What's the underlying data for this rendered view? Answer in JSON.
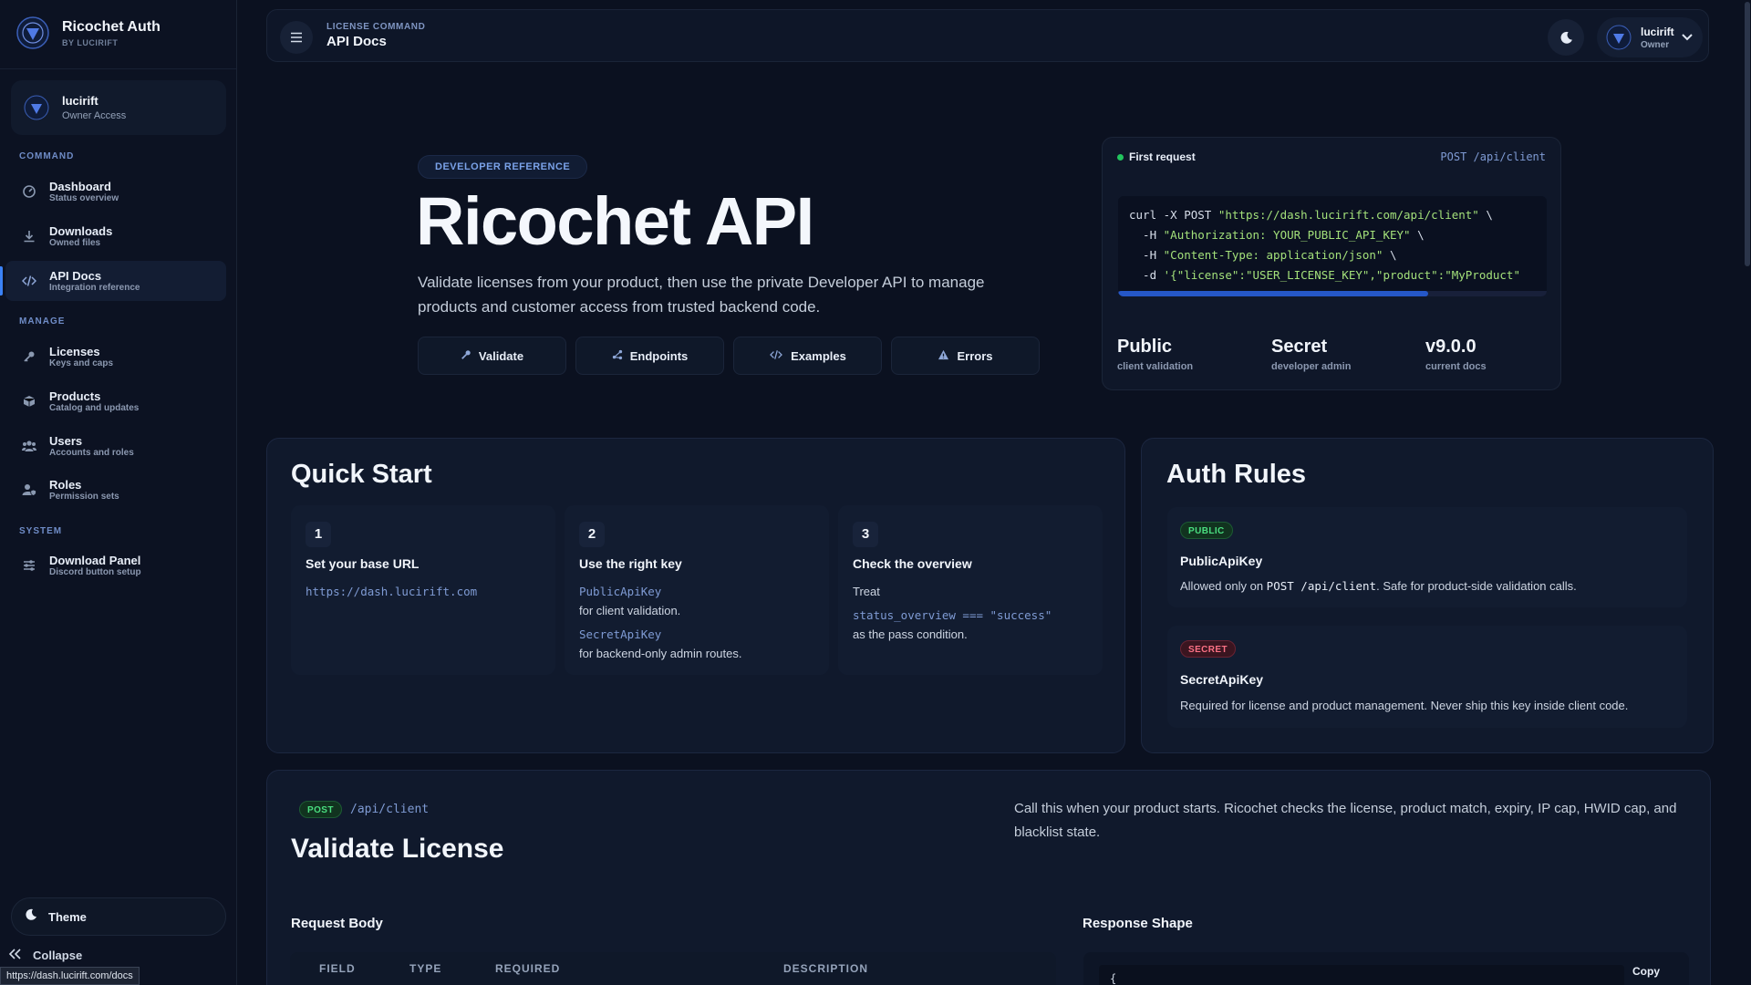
{
  "brand": {
    "title": "Ricochet Auth",
    "subtitle": "BY LUCIRIFT"
  },
  "user_card": {
    "name": "lucirift",
    "role": "Owner Access"
  },
  "sidebar": {
    "sections": {
      "command": "COMMAND",
      "manage": "MANAGE",
      "system": "SYSTEM"
    },
    "items": [
      {
        "label": "Dashboard",
        "sub": "Status overview",
        "icon": "dashboard-icon"
      },
      {
        "label": "Downloads",
        "sub": "Owned files",
        "icon": "download-icon"
      },
      {
        "label": "API Docs",
        "sub": "Integration reference",
        "icon": "code-icon",
        "active": true
      },
      {
        "label": "Licenses",
        "sub": "Keys and caps",
        "icon": "key-icon"
      },
      {
        "label": "Products",
        "sub": "Catalog and updates",
        "icon": "box-icon"
      },
      {
        "label": "Users",
        "sub": "Accounts and roles",
        "icon": "users-icon"
      },
      {
        "label": "Roles",
        "sub": "Permission sets",
        "icon": "user-shield-icon"
      },
      {
        "label": "Download Panel",
        "sub": "Discord button setup",
        "icon": "sliders-icon"
      }
    ],
    "theme_label": "Theme",
    "collapse_label": "Collapse"
  },
  "status_url": "https://dash.lucirift.com/docs",
  "topbar": {
    "eyebrow": "LICENSE COMMAND",
    "title": "API Docs",
    "user_name": "lucirift",
    "user_role": "Owner"
  },
  "hero": {
    "pill": "DEVELOPER REFERENCE",
    "title": "Ricochet API",
    "description": "Validate licenses from your product, then use the private Developer API to manage products and customer access from trusted backend code.",
    "tabs": [
      {
        "label": "Validate",
        "icon": "key-icon"
      },
      {
        "label": "Endpoints",
        "icon": "share-icon"
      },
      {
        "label": "Examples",
        "icon": "code-icon"
      },
      {
        "label": "Errors",
        "icon": "warning-icon"
      }
    ]
  },
  "first_request": {
    "label": "First request",
    "endpoint": "POST /api/client",
    "code": {
      "line1_cmd": "curl -X POST ",
      "line1_str": "\"https://dash.lucirift.com/api/client\"",
      "line1_end": " \\",
      "line2_cmd": "  -H ",
      "line2_str": "\"Authorization: YOUR_PUBLIC_API_KEY\"",
      "line2_end": " \\",
      "line3_cmd": "  -H ",
      "line3_str": "\"Content-Type: application/json\"",
      "line3_end": " \\",
      "line4_cmd": "  -d ",
      "line4_str": "'{\"license\":\"USER_LICENSE_KEY\",\"product\":\"MyProduct\""
    },
    "stats": [
      {
        "value": "Public",
        "label": "client validation"
      },
      {
        "value": "Secret",
        "label": "developer admin"
      },
      {
        "value": "v9.0.0",
        "label": "current docs"
      }
    ]
  },
  "quick_start": {
    "title": "Quick Start",
    "steps": [
      {
        "num": "1",
        "title": "Set your base URL",
        "code": "https://dash.lucirift.com"
      },
      {
        "num": "2",
        "title": "Use the right key",
        "code1": "PublicApiKey",
        "text1": "for client validation.",
        "code2": "SecretApiKey",
        "text2": "for backend-only admin routes."
      },
      {
        "num": "3",
        "title": "Check the overview",
        "text1": "Treat",
        "code1": "status_overview",
        "op": " === ",
        "code_str": "\"success\"",
        "text2": "as the pass condition."
      }
    ]
  },
  "auth_rules": {
    "title": "Auth Rules",
    "rules": [
      {
        "badge": "PUBLIC",
        "title": "PublicApiKey",
        "desc_pre": "Allowed only on ",
        "desc_code": "POST /api/client",
        "desc_post": ". Safe for product-side validation calls."
      },
      {
        "badge": "SECRET",
        "title": "SecretApiKey",
        "desc": "Required for license and product management. Never ship this key inside client code."
      }
    ]
  },
  "validate_license": {
    "method": "POST",
    "path": "/api/client",
    "title": "Validate License",
    "description": "Call this when your product starts. Ricochet checks the license, product match, expiry, IP cap, HWID cap, and blacklist state.",
    "request_body_label": "Request Body",
    "columns": [
      "FIELD",
      "TYPE",
      "REQUIRED",
      "DESCRIPTION"
    ],
    "response_label": "Response Shape",
    "response_code_start": "{",
    "copy_label": "Copy"
  },
  "colors": {
    "accent": "#3b82f6",
    "success": "#22c55e",
    "danger": "#fb7185",
    "background": "#0b1120"
  }
}
